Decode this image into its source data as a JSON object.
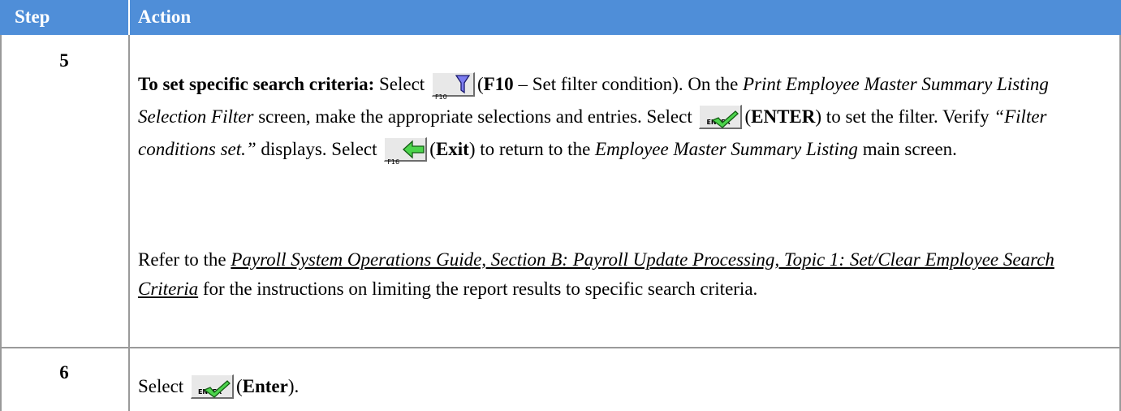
{
  "header": {
    "col_step": "Step",
    "col_action": "Action"
  },
  "rows": [
    {
      "step": "5",
      "p1": {
        "lead": "To set specific search criteria:",
        "select1": "Select",
        "f10_key": "F10",
        "f10_label": "F10",
        "f10_text": " – Set filter condition).  On the ",
        "screen_name": "Print Employee Master Summary Listing Selection Filter",
        "after_screen": " screen, make the appropriate selections and entries.  Select",
        "enter_key": "ENTER",
        "enter_label": "ENTER",
        "to_set": ") to set the filter.  Verify ",
        "msg": "“Filter conditions set.”",
        "displays": "displays.  Select",
        "f16_key": "F16",
        "exit_label": "Exit",
        "to_return": ") to return to the ",
        "main_screen": "Employee Master Summary Listing",
        "main_after": " main screen."
      },
      "p2": {
        "refer": "Refer to the ",
        "guide": "Payroll System Operations Guide, Section B:  Payroll Update Processing, Topic 1:  Set/Clear Employee Search Criteria",
        "rest": " for the instructions on limiting the report results to specific search criteria."
      }
    },
    {
      "step": "6",
      "select": "Select",
      "enter_key": "ENTER",
      "enter_label": "Enter",
      "end": ")."
    }
  ],
  "colors": {
    "header_bg": "#4f8ed8",
    "header_text": "#ffffff",
    "grid": "#9a9a9a"
  },
  "icons": [
    "filter-funnel-icon",
    "enter-checkmark-icon",
    "exit-arrow-icon"
  ]
}
